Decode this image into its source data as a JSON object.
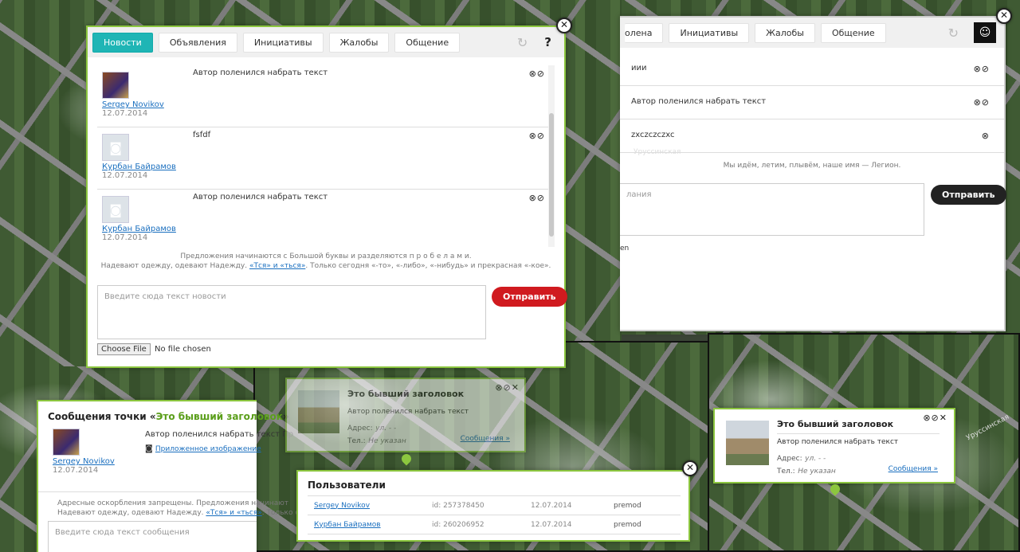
{
  "left_panel": {
    "tabs": [
      {
        "label": "Новости",
        "active": true
      },
      {
        "label": "Объявления"
      },
      {
        "label": "Инициативы"
      },
      {
        "label": "Жалобы"
      },
      {
        "label": "Общение"
      }
    ],
    "help_label": "?",
    "items": [
      {
        "author": "Sergey Novikov",
        "date": "12.07.2014",
        "text": "Автор поленился набрать текст",
        "icons": "⊗⊘"
      },
      {
        "author": "Курбан Байрамов",
        "date": "12.07.2014",
        "text": "fsfdf",
        "icons": "⊗⊘"
      },
      {
        "author": "Курбан Байрамов",
        "date": "12.07.2014",
        "text": "Автор поленился набрать текст",
        "icons": "⊗⊘"
      }
    ],
    "hint_line1": "Предложения начинаются с Большой буквы и разделяются п р о б е л а м и.",
    "hint_line2_pre": "Надевают одежду, одевают Надежду.",
    "hint_line2_link": "«Тся» и «ться»",
    "hint_line2_post": ". Только сегодня «-то», «-либо», «-нибудь» и прекрасная «-кое».",
    "textarea_placeholder": "Введите сюда текст новости",
    "send_label": "Отправить",
    "file_button": "Choose File",
    "file_status": "No file chosen"
  },
  "right_panel": {
    "tabs": [
      "олена",
      "Инициативы",
      "Жалобы",
      "Общение"
    ],
    "items": [
      {
        "text": "иии",
        "icons": "⊗⊘"
      },
      {
        "text": "Автор поленился набрать текст",
        "icons": "⊗⊘"
      },
      {
        "text": "zxczczczxc",
        "icons": "⊗"
      }
    ],
    "hint": "Мы идём, летим, плывём, наше имя — Легион.",
    "textarea_placeholder": "лания",
    "send_label": "Отправить",
    "partial_text": "en"
  },
  "bottom_left_panel": {
    "title_prefix": "Сообщения точки «",
    "title_highlight": "Это бывший заголовок",
    "title_suffix": "»",
    "item": {
      "author": "Sergey Novikov",
      "date": "12.07.2014",
      "text": "Автор поленился набрать текст Пр",
      "attachment": "Приложенное изображение"
    },
    "hint_line1": "Адресные оскорбления запрещены. Предложения начинают",
    "hint_line2_pre": "Надевают одежду, одевают Надежду.",
    "hint_line2_link": "«Тся» и «ться»",
    "hint_line2_post": ". Только се",
    "textarea_placeholder": "Введите сюда текст сообщения"
  },
  "middle_popup": {
    "title": "Это бывший заголовок",
    "text": "Автор поленился набрать текст",
    "address_label": "Адрес:",
    "address_value": "ул. - -",
    "phone_label": "Тел.:",
    "phone_value": "Не указан",
    "messages_link": "Сообщения »",
    "icons": "⊗⊘✕"
  },
  "users_panel": {
    "title": "Пользователи",
    "rows": [
      {
        "name": "Sergey Novikov",
        "id": "id: 257378450",
        "date": "12.07.2014",
        "status": "premod"
      },
      {
        "name": "Курбан Байрамов",
        "id": "id: 260206952",
        "date": "12.07.2014",
        "status": "premod"
      }
    ]
  },
  "right_popup": {
    "title": "Это бывший заголовок",
    "text": "Автор поленился набрать текст",
    "address_label": "Адрес:",
    "address_value": "ул. - -",
    "phone_label": "Тел.:",
    "phone_value": "Не указан",
    "messages_link": "Сообщения »",
    "icons": "⊗⊘✕"
  },
  "map_labels": [
    "Уруссинская",
    "Уруссинская"
  ],
  "close_symbol": "✕",
  "colors": {
    "accent_green": "#8cc63f",
    "tab_active": "#1fb5b5",
    "send_red": "#d01a1f",
    "link": "#1a6fbf"
  }
}
